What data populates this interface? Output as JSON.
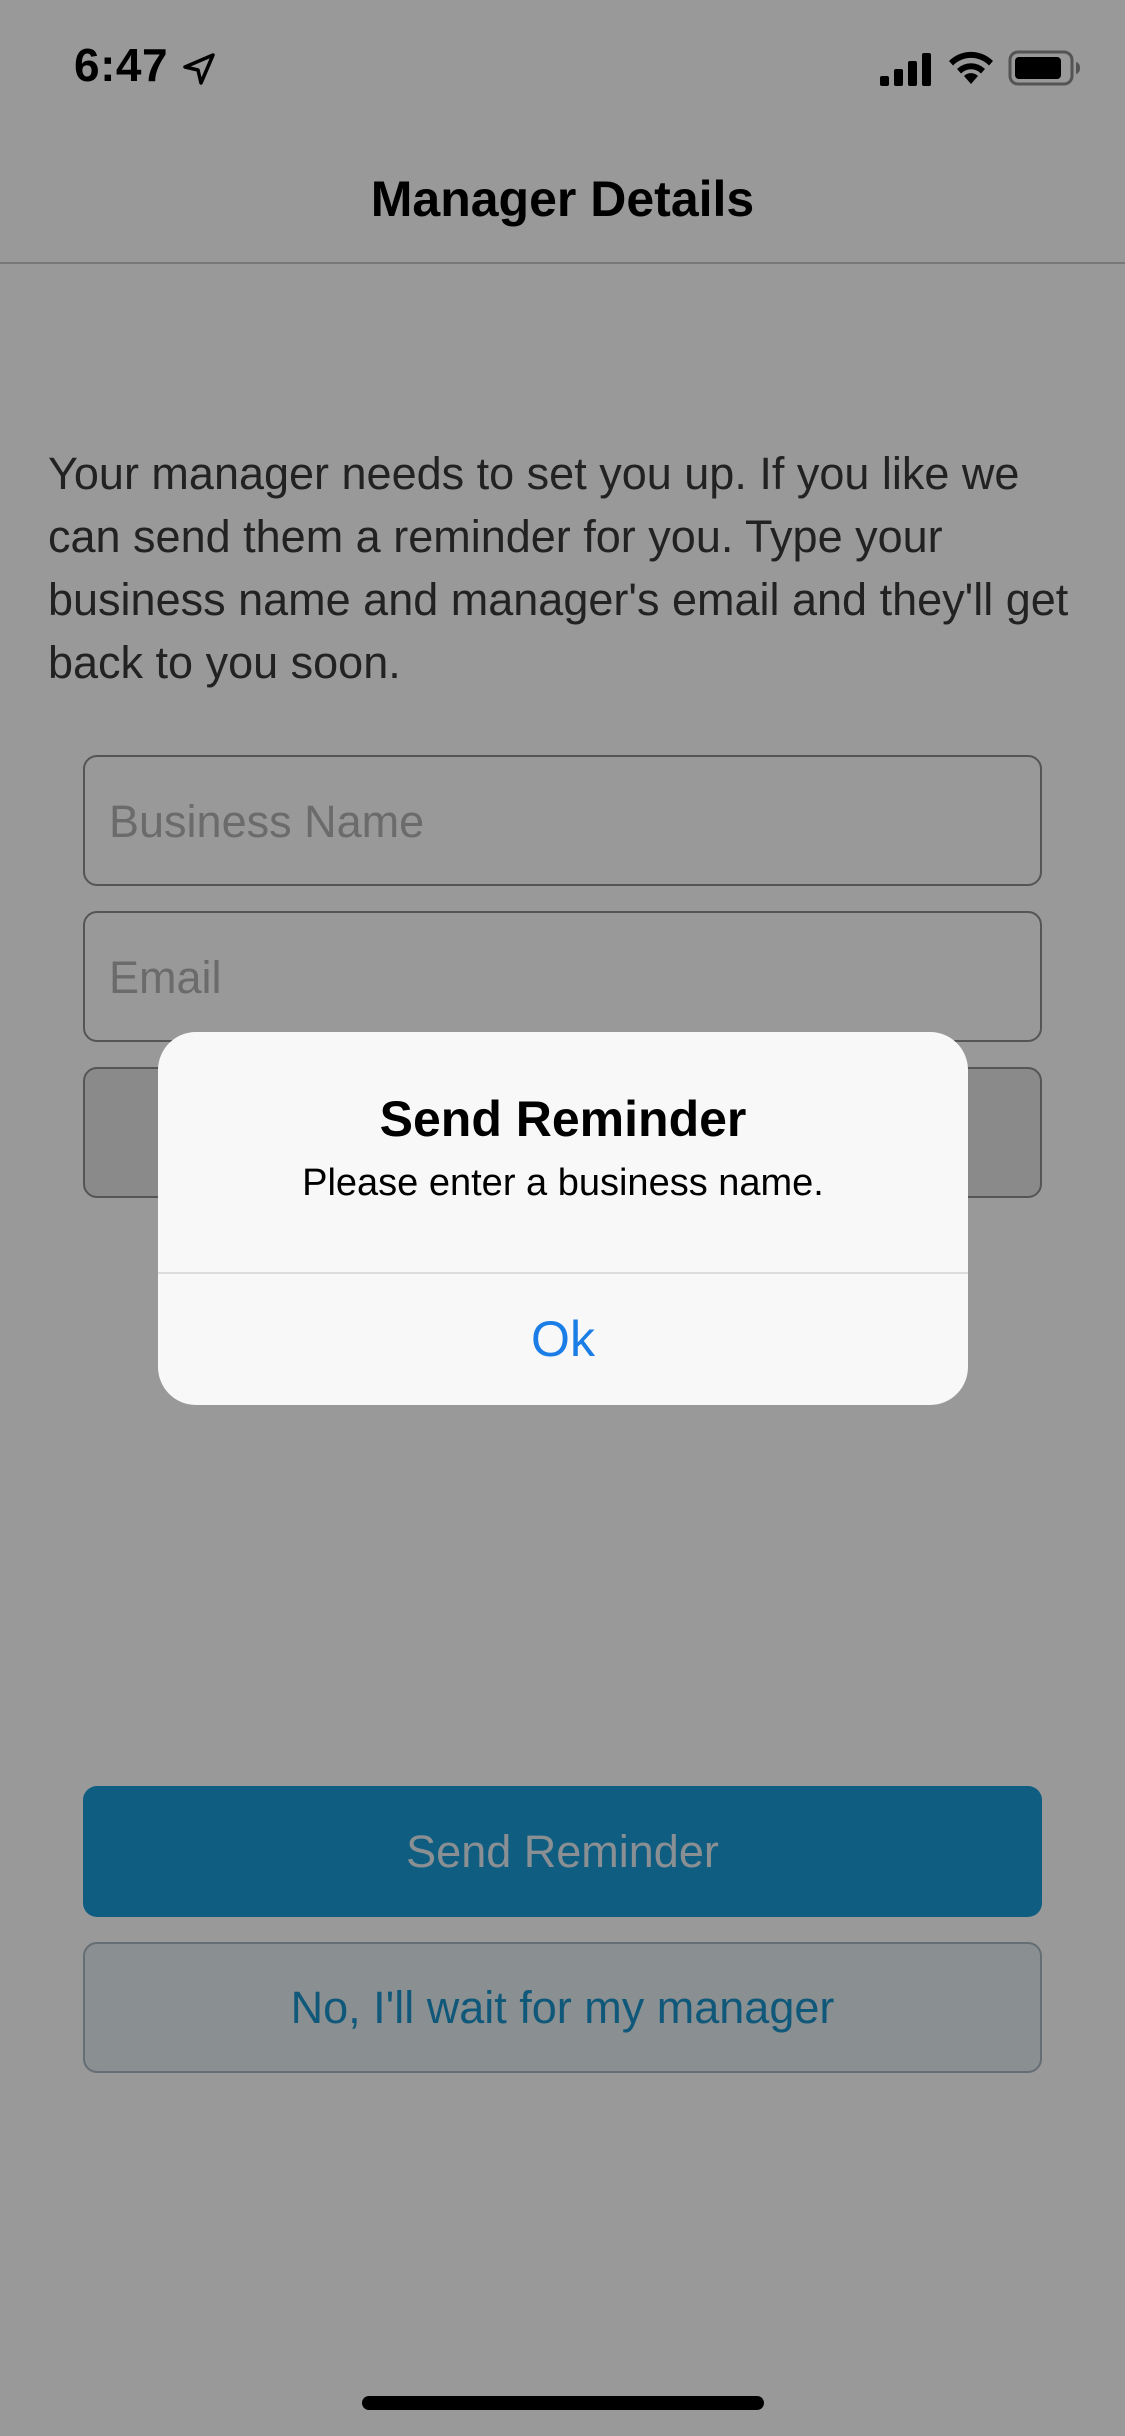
{
  "status_bar": {
    "time": "6:47",
    "icons": [
      "location-arrow-icon",
      "cellular-signal-icon",
      "wifi-icon",
      "battery-icon"
    ]
  },
  "nav": {
    "title": "Manager Details"
  },
  "content": {
    "intro": "Your manager needs to set you up. If you like we can send them a reminder for you. Type your business name and manager's email and they'll get back to you soon.",
    "business_name_placeholder": "Business Name",
    "business_name_value": "",
    "email_placeholder": "Email",
    "email_value": "",
    "send_reminder_label": "Send Reminder",
    "wait_label": "No, I'll wait for my manager"
  },
  "alert": {
    "title": "Send Reminder",
    "message": "Please enter a business name.",
    "ok_label": "Ok"
  },
  "colors": {
    "primary": "#1a9bd7",
    "link_blue": "#1a7ee6",
    "overlay": "rgba(0,0,0,0.4)"
  }
}
